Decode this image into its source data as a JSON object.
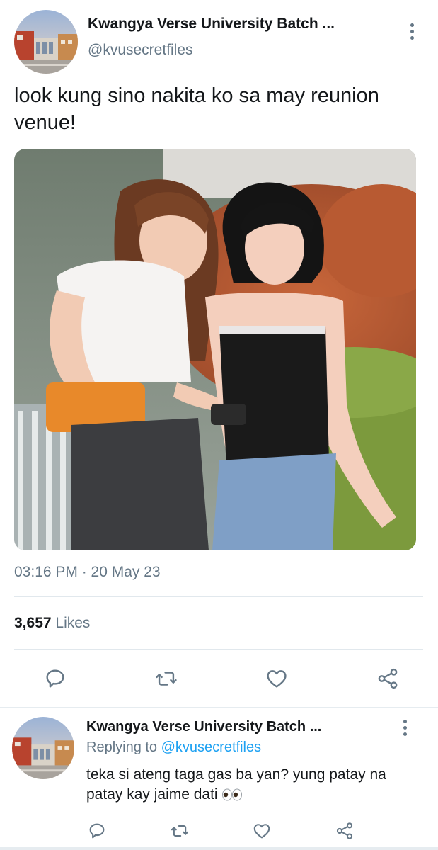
{
  "tweet": {
    "author_name": "Kwangya Verse University Batch ...",
    "author_handle": "@kvusecretfiles",
    "text": "look kung sino nakita ko sa may reunion venue!",
    "timestamp": "03:16 PM · 20 May 23",
    "likes_count": "3,657",
    "likes_label": "Likes"
  },
  "reply": {
    "author_name": "Kwangya Verse University Batch ...",
    "replying_label": "Replying to",
    "replying_to": "@kvusecretfiles",
    "text": "teka si ateng taga gas ba yan? yung patay na patay kay jaime dati",
    "emoji": "eyes-emoji"
  },
  "icons": {
    "reply": "reply-icon",
    "retweet": "retweet-icon",
    "like": "like-icon",
    "share": "share-icon",
    "more": "more-vertical-icon"
  },
  "colors": {
    "text": "#14171a",
    "secondary": "#657786",
    "link": "#1da1f2",
    "divider": "#e1e8ed"
  }
}
